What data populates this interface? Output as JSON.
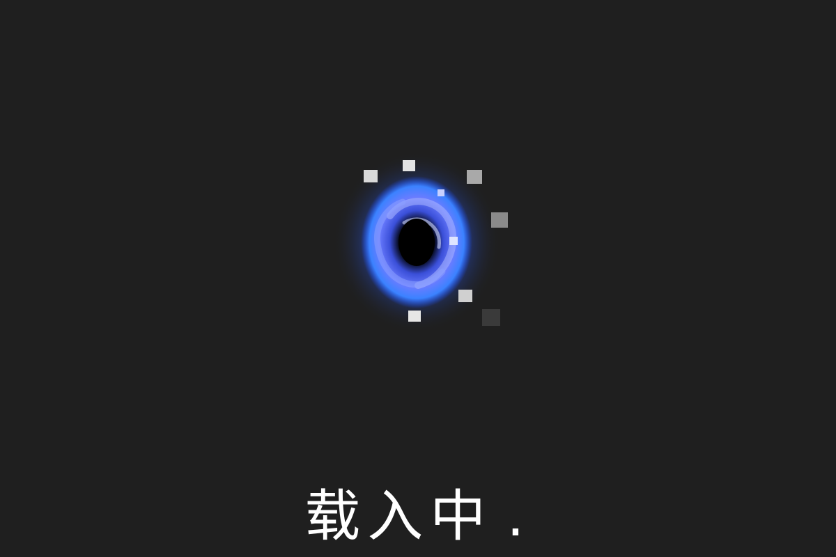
{
  "loading": {
    "label": "载入中",
    "dots": "."
  },
  "icon": {
    "name": "vortex-portal-icon",
    "glow_color": "#2f6bff",
    "core_color": "#000000",
    "pixel_color": "#d8d8d8"
  },
  "colors": {
    "background": "#1f1f1f",
    "text": "#ffffff"
  }
}
